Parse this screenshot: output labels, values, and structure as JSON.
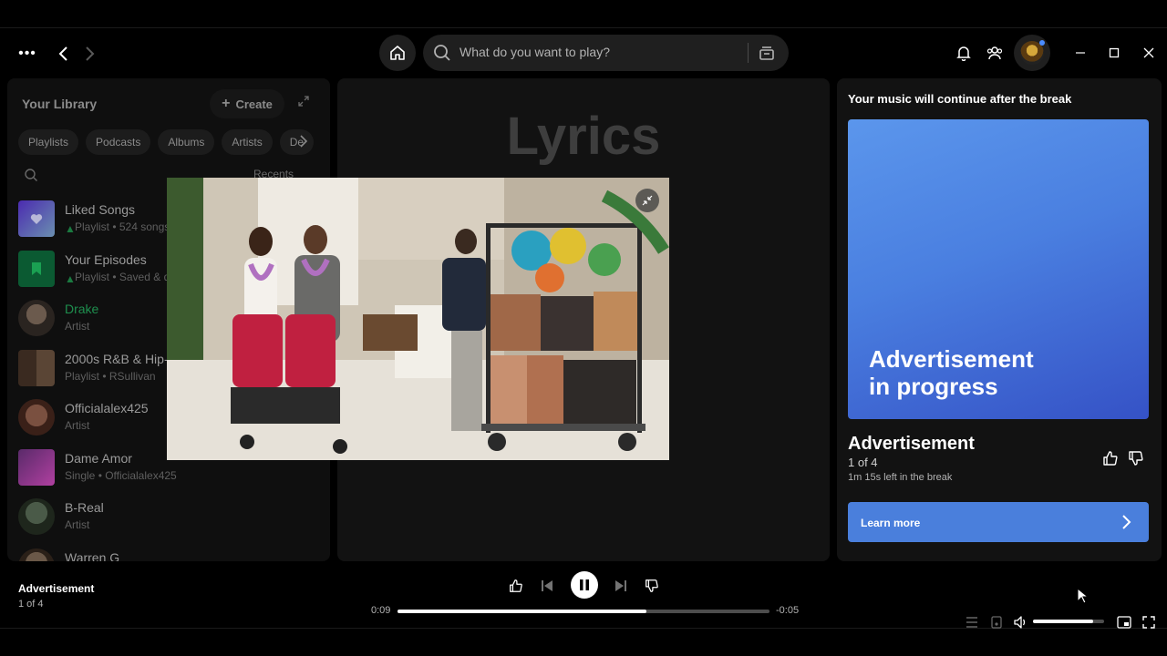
{
  "topbar": {
    "search_placeholder": "What do you want to play?"
  },
  "library": {
    "title": "Your Library",
    "create_label": "Create",
    "chips": [
      "Playlists",
      "Podcasts",
      "Albums",
      "Artists",
      "De"
    ],
    "recents_label": "Recents",
    "items": [
      {
        "name": "Liked Songs",
        "sub": "Playlist • 524 songs",
        "pinned": true
      },
      {
        "name": "Your Episodes",
        "sub": "Playlist • Saved & d",
        "pinned": true
      },
      {
        "name": "Drake",
        "sub": "Artist",
        "pinned": false
      },
      {
        "name": "2000s R&B & Hip-",
        "sub": "Playlist • RSullivan",
        "pinned": false
      },
      {
        "name": "Officialalex425",
        "sub": "Artist",
        "pinned": false
      },
      {
        "name": "Dame Amor",
        "sub": "Single • Officialalex425",
        "pinned": false
      },
      {
        "name": "B-Real",
        "sub": "Artist",
        "pinned": false
      },
      {
        "name": "Warren G",
        "sub": "",
        "pinned": false
      }
    ]
  },
  "main": {
    "heading": "Lyrics"
  },
  "ad_panel": {
    "notice": "Your music will continue after the break",
    "art_text_line1": "Advertisement",
    "art_text_line2": "in progress",
    "title": "Advertisement",
    "count": "1 of 4",
    "time_left": "1m 15s left in the break",
    "learn_more": "Learn more"
  },
  "player": {
    "now_playing_title": "Advertisement",
    "now_playing_sub": "1 of 4",
    "elapsed": "0:09",
    "remaining": "-0:05",
    "progress_fraction": 0.67,
    "volume_fraction": 0.85
  },
  "colors": {
    "accent_green": "#1e8f4e",
    "ad_blue": "#4a7fdc"
  }
}
